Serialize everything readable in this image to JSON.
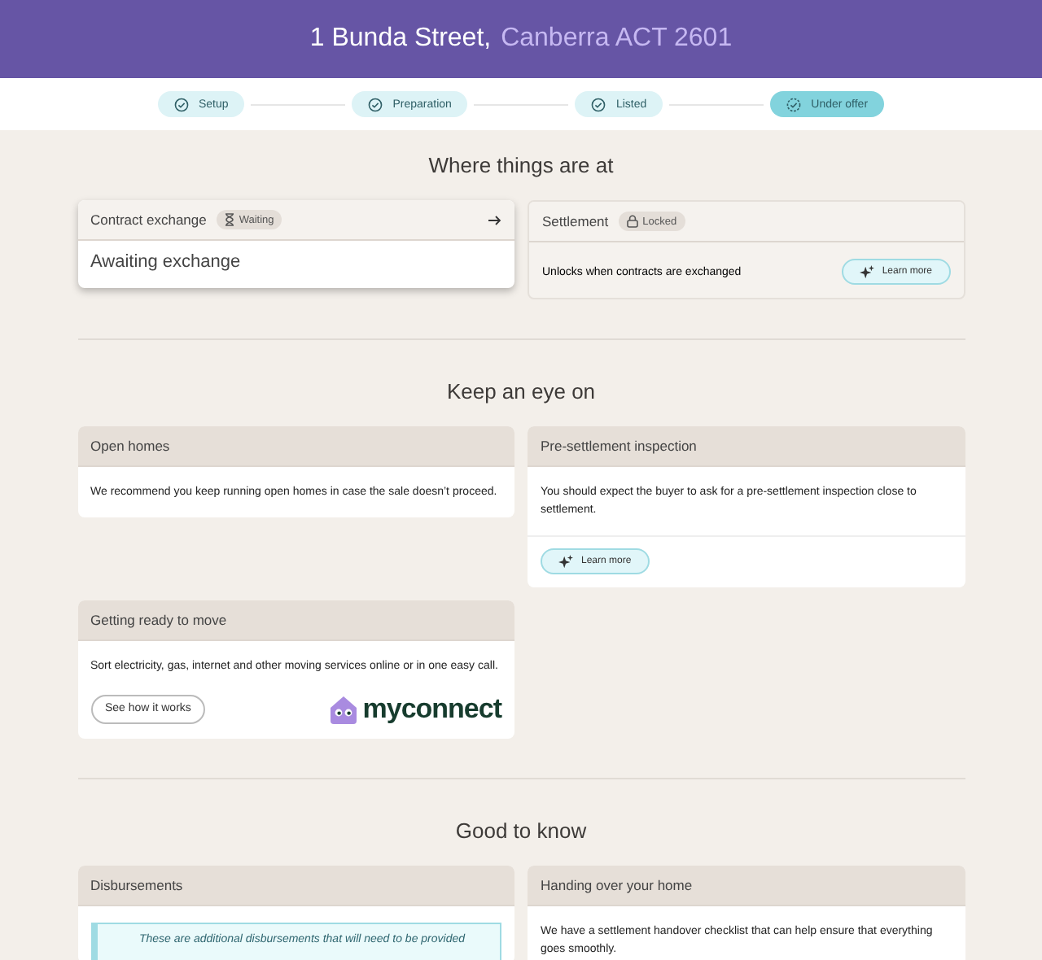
{
  "header": {
    "street": "1 Bunda Street,",
    "locality": "Canberra ACT 2601"
  },
  "steps": [
    {
      "label": "Setup",
      "kind": "done"
    },
    {
      "label": "Preparation",
      "kind": "done"
    },
    {
      "label": "Listed",
      "kind": "done"
    },
    {
      "label": "Under offer",
      "kind": "current"
    }
  ],
  "status_section": {
    "title": "Where things are at",
    "cards": [
      {
        "title": "Contract exchange",
        "badge": "Waiting",
        "kind": "active",
        "body": "Awaiting exchange"
      },
      {
        "title": "Settlement",
        "badge": "Locked",
        "kind": "locked",
        "body": "Unlocks when contracts are exchanged",
        "button": "Learn more"
      }
    ]
  },
  "watch_section": {
    "title": "Keep an eye on",
    "cards": [
      {
        "title": "Open homes",
        "body": "We recommend you keep running open homes in case the sale doesn’t proceed."
      },
      {
        "title": "Pre-settlement inspection",
        "body": "You should expect the buyer to ask for a pre-settlement inspection close to settlement.",
        "button": "Learn more"
      },
      {
        "title": "Getting ready to move",
        "body": "Sort electricity, gas, internet and other moving services online or in one easy call.",
        "link_button": "See how it works",
        "logo": "myconnect"
      }
    ]
  },
  "know_section": {
    "title": "Good to know",
    "cards": [
      {
        "title": "Disbursements",
        "note": "These are additional disbursements that will need to be provided"
      },
      {
        "title": "Handing over your home",
        "body": "We have a settlement handover checklist that can help ensure that everything goes smoothly."
      }
    ]
  }
}
